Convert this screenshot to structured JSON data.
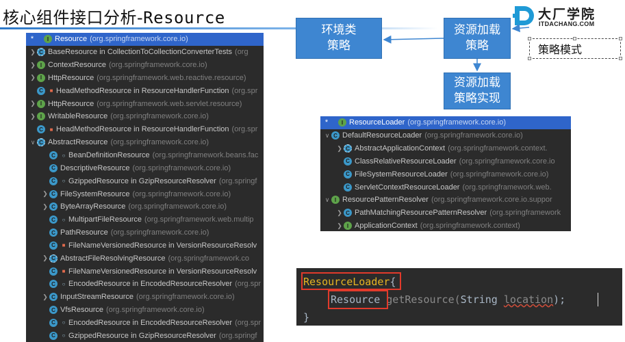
{
  "title": {
    "cn": "核心组件接口分析-",
    "en": "Resource"
  },
  "logo": {
    "cn": "大厂学院",
    "en": "ITDACHANG.COM",
    "colors": {
      "mark": "#1f9ad6",
      "text": "#1d1d1d"
    }
  },
  "boxes": {
    "env": [
      "环境类",
      "策略"
    ],
    "load": [
      "资源加载",
      "策略"
    ],
    "impl": [
      "资源加载",
      "策略实现"
    ]
  },
  "pattern_label": "策略模式",
  "colors": {
    "box_blue": "#3e86d1",
    "ide_bg": "#2b2b2b",
    "selection": "#2f65ca",
    "red_box": "#e23a2b"
  },
  "left_tree": [
    {
      "indent": 0,
      "arrow": "",
      "star": true,
      "icon": "i",
      "mod": "",
      "name": "Resource",
      "pkg": "(org.springframework.core.io)",
      "selected": true
    },
    {
      "indent": 0,
      "arrow": "right",
      "icon": "a",
      "mod": "",
      "name": "BaseResource in CollectionToCollectionConverterTests",
      "pkg": "(org"
    },
    {
      "indent": 0,
      "arrow": "right",
      "icon": "i",
      "mod": "",
      "name": "ContextResource",
      "pkg": "(org.springframework.core.io)"
    },
    {
      "indent": 0,
      "arrow": "right",
      "icon": "i",
      "mod": "",
      "name": "HttpResource",
      "pkg": "(org.springframework.web.reactive.resource)"
    },
    {
      "indent": 0,
      "arrow": "",
      "icon": "c",
      "mod": "lock",
      "name": "HeadMethodResource in ResourceHandlerFunction",
      "pkg": "(org.spr"
    },
    {
      "indent": 0,
      "arrow": "right",
      "icon": "i",
      "mod": "",
      "name": "HttpResource",
      "pkg": "(org.springframework.web.servlet.resource)"
    },
    {
      "indent": 0,
      "arrow": "right",
      "icon": "i",
      "mod": "",
      "name": "WritableResource",
      "pkg": "(org.springframework.core.io)"
    },
    {
      "indent": 0,
      "arrow": "",
      "icon": "c",
      "mod": "lock",
      "name": "HeadMethodResource in ResourceHandlerFunction",
      "pkg": "(org.spr"
    },
    {
      "indent": 0,
      "arrow": "down",
      "icon": "a",
      "mod": "",
      "name": "AbstractResource",
      "pkg": "(org.springframework.core.io)"
    },
    {
      "indent": 1,
      "arrow": "",
      "icon": "c",
      "mod": "dot",
      "name": "BeanDefinitionResource",
      "pkg": "(org.springframework.beans.fac"
    },
    {
      "indent": 1,
      "arrow": "",
      "icon": "c",
      "mod": "",
      "name": "DescriptiveResource",
      "pkg": "(org.springframework.core.io)"
    },
    {
      "indent": 1,
      "arrow": "",
      "icon": "c",
      "mod": "dot",
      "name": "GzippedResource in GzipResourceResolver",
      "pkg": "(org.springf"
    },
    {
      "indent": 1,
      "arrow": "right",
      "icon": "c",
      "mod": "",
      "name": "FileSystemResource",
      "pkg": "(org.springframework.core.io)"
    },
    {
      "indent": 1,
      "arrow": "right",
      "icon": "c",
      "mod": "",
      "name": "ByteArrayResource",
      "pkg": "(org.springframework.core.io)"
    },
    {
      "indent": 1,
      "arrow": "",
      "icon": "c",
      "mod": "dot",
      "name": "MultipartFileResource",
      "pkg": "(org.springframework.web.multip"
    },
    {
      "indent": 1,
      "arrow": "",
      "icon": "c",
      "mod": "",
      "name": "PathResource",
      "pkg": "(org.springframework.core.io)"
    },
    {
      "indent": 1,
      "arrow": "",
      "icon": "c",
      "mod": "lock",
      "name": "FileNameVersionedResource in VersionResourceResolv",
      "pkg": ""
    },
    {
      "indent": 1,
      "arrow": "right",
      "icon": "a",
      "mod": "",
      "name": "AbstractFileResolvingResource",
      "pkg": "(org.springframework.co"
    },
    {
      "indent": 1,
      "arrow": "",
      "icon": "c",
      "mod": "lock",
      "name": "FileNameVersionedResource in VersionResourceResolv",
      "pkg": ""
    },
    {
      "indent": 1,
      "arrow": "",
      "icon": "c",
      "mod": "dot",
      "name": "EncodedResource in EncodedResourceResolver",
      "pkg": "(org.spr"
    },
    {
      "indent": 1,
      "arrow": "right",
      "icon": "c",
      "mod": "",
      "name": "InputStreamResource",
      "pkg": "(org.springframework.core.io)"
    },
    {
      "indent": 1,
      "arrow": "",
      "icon": "c",
      "mod": "",
      "name": "VfsResource",
      "pkg": "(org.springframework.core.io)"
    },
    {
      "indent": 1,
      "arrow": "",
      "icon": "c",
      "mod": "dot",
      "name": "EncodedResource in EncodedResourceResolver",
      "pkg": "(org.spr"
    },
    {
      "indent": 1,
      "arrow": "",
      "icon": "c",
      "mod": "dot",
      "name": "GzippedResource in GzipResourceResolver",
      "pkg": "(org.springf"
    }
  ],
  "right_tree": [
    {
      "indent": 0,
      "arrow": "",
      "star": true,
      "icon": "i",
      "mod": "",
      "name": "ResourceLoader",
      "pkg": "(org.springframework.core.io)",
      "selected": true
    },
    {
      "indent": 0,
      "arrow": "down",
      "icon": "c",
      "mod": "",
      "name": "DefaultResourceLoader",
      "pkg": "(org.springframework.core.io)"
    },
    {
      "indent": 1,
      "arrow": "right",
      "icon": "a",
      "mod": "",
      "name": "AbstractApplicationContext",
      "pkg": "(org.springframework.context."
    },
    {
      "indent": 1,
      "arrow": "",
      "icon": "c",
      "mod": "",
      "name": "ClassRelativeResourceLoader",
      "pkg": "(org.springframework.core.io"
    },
    {
      "indent": 1,
      "arrow": "",
      "icon": "c",
      "mod": "",
      "name": "FileSystemResourceLoader",
      "pkg": "(org.springframework.core.io)"
    },
    {
      "indent": 1,
      "arrow": "",
      "icon": "c",
      "mod": "",
      "name": "ServletContextResourceLoader",
      "pkg": "(org.springframework.web."
    },
    {
      "indent": 0,
      "arrow": "down",
      "icon": "i",
      "mod": "",
      "name": "ResourcePatternResolver",
      "pkg": "(org.springframework.core.io.suppor"
    },
    {
      "indent": 1,
      "arrow": "right",
      "icon": "c",
      "mod": "",
      "name": "PathMatchingResourcePatternResolver",
      "pkg": "(org.springframework"
    },
    {
      "indent": 1,
      "arrow": "right",
      "icon": "i",
      "mod": "",
      "name": "ApplicationContext",
      "pkg": "(org.springframework.context)"
    }
  ],
  "code": {
    "interface": "ResourceLoader",
    "open_brace": "{",
    "return_type": "Resource",
    "method": "getResource",
    "param_type": "String",
    "param_name": "location",
    "close": ");",
    "end_brace": "}"
  }
}
